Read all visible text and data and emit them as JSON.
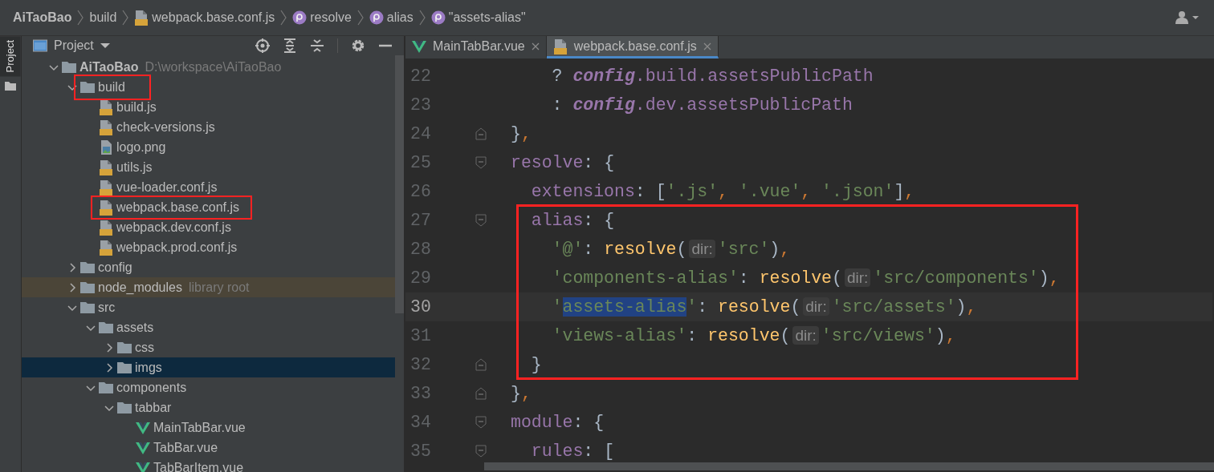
{
  "breadcrumbs": [
    {
      "text": "AiTaoBao",
      "kind": "project"
    },
    {
      "text": "build",
      "kind": "folder"
    },
    {
      "text": "webpack.base.conf.js",
      "kind": "js"
    },
    {
      "text": "resolve",
      "kind": "property"
    },
    {
      "text": "alias",
      "kind": "property"
    },
    {
      "text": "\"assets-alias\"",
      "kind": "property"
    }
  ],
  "side_stripe": {
    "label": "Project"
  },
  "project_panel": {
    "title": "Project",
    "tree": [
      {
        "label": "AiTaoBao",
        "kind": "project",
        "hint": "D:\\workspace\\AiTaoBao",
        "expanded": true,
        "selected": false,
        "boxed": false,
        "library": false,
        "children": [
          {
            "label": "build",
            "kind": "folder",
            "expanded": true,
            "selected": false,
            "boxed": true,
            "library": false,
            "children": [
              {
                "label": "build.js",
                "kind": "js",
                "selected": false,
                "boxed": false,
                "library": false
              },
              {
                "label": "check-versions.js",
                "kind": "js",
                "selected": false,
                "boxed": false,
                "library": false
              },
              {
                "label": "logo.png",
                "kind": "image",
                "selected": false,
                "boxed": false,
                "library": false
              },
              {
                "label": "utils.js",
                "kind": "js",
                "selected": false,
                "boxed": false,
                "library": false
              },
              {
                "label": "vue-loader.conf.js",
                "kind": "js",
                "selected": false,
                "boxed": false,
                "library": false
              },
              {
                "label": "webpack.base.conf.js",
                "kind": "js",
                "selected": false,
                "boxed": true,
                "library": false
              },
              {
                "label": "webpack.dev.conf.js",
                "kind": "js",
                "selected": false,
                "boxed": false,
                "library": false
              },
              {
                "label": "webpack.prod.conf.js",
                "kind": "js",
                "selected": false,
                "boxed": false,
                "library": false
              }
            ]
          },
          {
            "label": "config",
            "kind": "folder",
            "expanded": false,
            "selected": false,
            "boxed": false,
            "library": false
          },
          {
            "label": "node_modules",
            "kind": "folder",
            "hint": "library root",
            "expanded": false,
            "selected": false,
            "boxed": false,
            "library": true
          },
          {
            "label": "src",
            "kind": "folder",
            "expanded": true,
            "selected": false,
            "boxed": false,
            "library": false,
            "children": [
              {
                "label": "assets",
                "kind": "folder",
                "expanded": true,
                "selected": false,
                "boxed": false,
                "library": false,
                "children": [
                  {
                    "label": "css",
                    "kind": "folder",
                    "expanded": false,
                    "selected": false,
                    "boxed": false,
                    "library": false
                  },
                  {
                    "label": "imgs",
                    "kind": "folder",
                    "expanded": false,
                    "selected": true,
                    "boxed": false,
                    "library": false
                  }
                ]
              },
              {
                "label": "components",
                "kind": "folder",
                "expanded": true,
                "selected": false,
                "boxed": false,
                "library": false,
                "children": [
                  {
                    "label": "tabbar",
                    "kind": "folder",
                    "expanded": true,
                    "selected": false,
                    "boxed": false,
                    "library": false,
                    "children": [
                      {
                        "label": "MainTabBar.vue",
                        "kind": "vue",
                        "selected": false,
                        "boxed": false,
                        "library": false
                      },
                      {
                        "label": "TabBar.vue",
                        "kind": "vue",
                        "selected": false,
                        "boxed": false,
                        "library": false
                      },
                      {
                        "label": "TabBarItem.vue",
                        "kind": "vue",
                        "selected": false,
                        "boxed": false,
                        "library": false
                      }
                    ]
                  }
                ]
              }
            ]
          }
        ]
      }
    ]
  },
  "editor": {
    "tabs": [
      {
        "label": "MainTabBar.vue",
        "kind": "vue",
        "selected": false
      },
      {
        "label": "webpack.base.conf.js",
        "kind": "js",
        "selected": true
      }
    ],
    "lines": [
      {
        "number": "22",
        "current": false,
        "boxed": false,
        "fold_start": false,
        "fold_end": false,
        "tokens": [
          {
            "kind": "punct",
            "text": "    ? "
          },
          {
            "kind": "italic",
            "text": "config"
          },
          {
            "kind": "prop",
            "text": ".build.assetsPublicPath"
          }
        ]
      },
      {
        "number": "23",
        "current": false,
        "boxed": false,
        "fold_start": false,
        "fold_end": false,
        "tokens": [
          {
            "kind": "punct",
            "text": "    : "
          },
          {
            "kind": "italic",
            "text": "config"
          },
          {
            "kind": "prop",
            "text": ".dev.assetsPublicPath"
          }
        ]
      },
      {
        "number": "24",
        "current": false,
        "boxed": false,
        "fold_start": false,
        "fold_end": true,
        "tokens": [
          {
            "kind": "punct",
            "text": "}"
          },
          {
            "kind": "comma",
            "text": ","
          }
        ]
      },
      {
        "number": "25",
        "current": false,
        "boxed": false,
        "fold_start": true,
        "fold_end": false,
        "tokens": [
          {
            "kind": "prop",
            "text": "resolve"
          },
          {
            "kind": "punct",
            "text": ": {"
          }
        ]
      },
      {
        "number": "26",
        "current": false,
        "boxed": false,
        "fold_start": false,
        "fold_end": false,
        "tokens": [
          {
            "kind": "prop",
            "text": "  extensions"
          },
          {
            "kind": "punct",
            "text": ": ["
          },
          {
            "kind": "string",
            "text": "'.js'"
          },
          {
            "kind": "comma",
            "text": ", "
          },
          {
            "kind": "string",
            "text": "'.vue'"
          },
          {
            "kind": "comma",
            "text": ", "
          },
          {
            "kind": "string",
            "text": "'.json'"
          },
          {
            "kind": "punct",
            "text": "]"
          },
          {
            "kind": "comma",
            "text": ","
          }
        ]
      },
      {
        "number": "27",
        "current": false,
        "boxed": true,
        "fold_start": true,
        "fold_end": false,
        "tokens": [
          {
            "kind": "prop",
            "text": "  alias"
          },
          {
            "kind": "punct",
            "text": ": {"
          }
        ]
      },
      {
        "number": "28",
        "current": false,
        "boxed": true,
        "fold_start": false,
        "fold_end": false,
        "tokens": [
          {
            "kind": "string",
            "text": "    '@'"
          },
          {
            "kind": "punct",
            "text": ": "
          },
          {
            "kind": "func",
            "text": "resolve"
          },
          {
            "kind": "punct",
            "text": "("
          },
          {
            "kind": "hint",
            "text": "dir:"
          },
          {
            "kind": "string",
            "text": "'src'"
          },
          {
            "kind": "punct",
            "text": ")"
          },
          {
            "kind": "comma",
            "text": ","
          }
        ]
      },
      {
        "number": "29",
        "current": false,
        "boxed": true,
        "fold_start": false,
        "fold_end": false,
        "tokens": [
          {
            "kind": "string",
            "text": "    'components-alias'"
          },
          {
            "kind": "punct",
            "text": ": "
          },
          {
            "kind": "func",
            "text": "resolve"
          },
          {
            "kind": "punct",
            "text": "("
          },
          {
            "kind": "hint",
            "text": "dir:"
          },
          {
            "kind": "string",
            "text": "'src/components'"
          },
          {
            "kind": "punct",
            "text": ")"
          },
          {
            "kind": "comma",
            "text": ","
          }
        ]
      },
      {
        "number": "30",
        "current": true,
        "boxed": true,
        "fold_start": false,
        "fold_end": false,
        "tokens": [
          {
            "kind": "string",
            "text": "    '"
          },
          {
            "kind": "selection",
            "text": "assets-alias"
          },
          {
            "kind": "string",
            "text": "'"
          },
          {
            "kind": "punct",
            "text": ": "
          },
          {
            "kind": "func",
            "text": "resolve"
          },
          {
            "kind": "punct",
            "text": "("
          },
          {
            "kind": "hint",
            "text": "dir:"
          },
          {
            "kind": "string",
            "text": "'src/assets'"
          },
          {
            "kind": "punct",
            "text": ")"
          },
          {
            "kind": "comma",
            "text": ","
          }
        ]
      },
      {
        "number": "31",
        "current": false,
        "boxed": true,
        "fold_start": false,
        "fold_end": false,
        "tokens": [
          {
            "kind": "string",
            "text": "    'views-alias'"
          },
          {
            "kind": "punct",
            "text": ": "
          },
          {
            "kind": "func",
            "text": "resolve"
          },
          {
            "kind": "punct",
            "text": "("
          },
          {
            "kind": "hint",
            "text": "dir:"
          },
          {
            "kind": "string",
            "text": "'src/views'"
          },
          {
            "kind": "punct",
            "text": ")"
          },
          {
            "kind": "comma",
            "text": ","
          }
        ]
      },
      {
        "number": "32",
        "current": false,
        "boxed": true,
        "fold_start": false,
        "fold_end": true,
        "tokens": [
          {
            "kind": "punct",
            "text": "  }"
          }
        ]
      },
      {
        "number": "33",
        "current": false,
        "boxed": false,
        "fold_start": false,
        "fold_end": true,
        "tokens": [
          {
            "kind": "punct",
            "text": "}"
          },
          {
            "kind": "comma",
            "text": ","
          }
        ]
      },
      {
        "number": "34",
        "current": false,
        "boxed": false,
        "fold_start": true,
        "fold_end": false,
        "tokens": [
          {
            "kind": "prop",
            "text": "module"
          },
          {
            "kind": "punct",
            "text": ": {"
          }
        ]
      },
      {
        "number": "35",
        "current": false,
        "boxed": false,
        "fold_start": true,
        "fold_end": false,
        "tokens": [
          {
            "kind": "prop",
            "text": "  rules"
          },
          {
            "kind": "punct",
            "text": ": ["
          }
        ]
      }
    ]
  }
}
